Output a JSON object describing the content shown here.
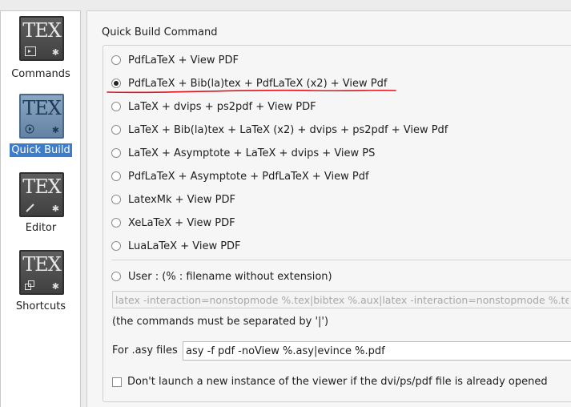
{
  "sidebar": {
    "items": [
      {
        "icon_text": "TEX",
        "icon_glyph": "terminal-icon",
        "label": "Commands"
      },
      {
        "icon_text": "TEX",
        "icon_glyph": "play-icon",
        "label": "Quick Build"
      },
      {
        "icon_text": "TEX",
        "icon_glyph": "pencil-icon",
        "label": "Editor"
      },
      {
        "icon_text": "TEX",
        "icon_glyph": "shortcut-icon",
        "label": "Shortcuts"
      }
    ],
    "selected_index": 1
  },
  "quick_build": {
    "title": "Quick Build Command",
    "options": [
      {
        "label": "PdfLaTeX + View PDF",
        "checked": false
      },
      {
        "label": "PdfLaTeX + Bib(la)tex + PdfLaTeX (x2) + View Pdf",
        "checked": true
      },
      {
        "label": "LaTeX + dvips + ps2pdf + View PDF",
        "checked": false
      },
      {
        "label": "LaTeX + Bib(la)tex + LaTeX (x2) + dvips + ps2pdf + View Pdf",
        "checked": false
      },
      {
        "label": "LaTeX + Asymptote + LaTeX + dvips + View PS",
        "checked": false
      },
      {
        "label": "PdfLaTeX + Asymptote + PdfLaTeX + View Pdf",
        "checked": false
      },
      {
        "label": "LatexMk + View PDF",
        "checked": false
      },
      {
        "label": "XeLaTeX + View PDF",
        "checked": false
      },
      {
        "label": "LuaLaTeX + View PDF",
        "checked": false
      }
    ],
    "user_option": {
      "label": "User : (% : filename without extension)",
      "checked": false
    },
    "user_command": "latex -interaction=nonstopmode %.tex|bibtex %.aux|latex -interaction=nonstopmode %.tex|latex -interaction=nonstopmode %.tex|dvips -o %.ps %.dvi",
    "separator_note": "(the commands must be separated by '|')",
    "asy_label": "For .asy files",
    "asy_command": "asy -f pdf -noView %.asy|evince %.pdf",
    "viewer_checkbox": {
      "label": "Don't launch a new instance of the viewer if the dvi/ps/pdf file is already opened",
      "checked": false
    }
  },
  "colors": {
    "selection": "#3d7cc9",
    "annotation_underline": "#e0141e"
  }
}
